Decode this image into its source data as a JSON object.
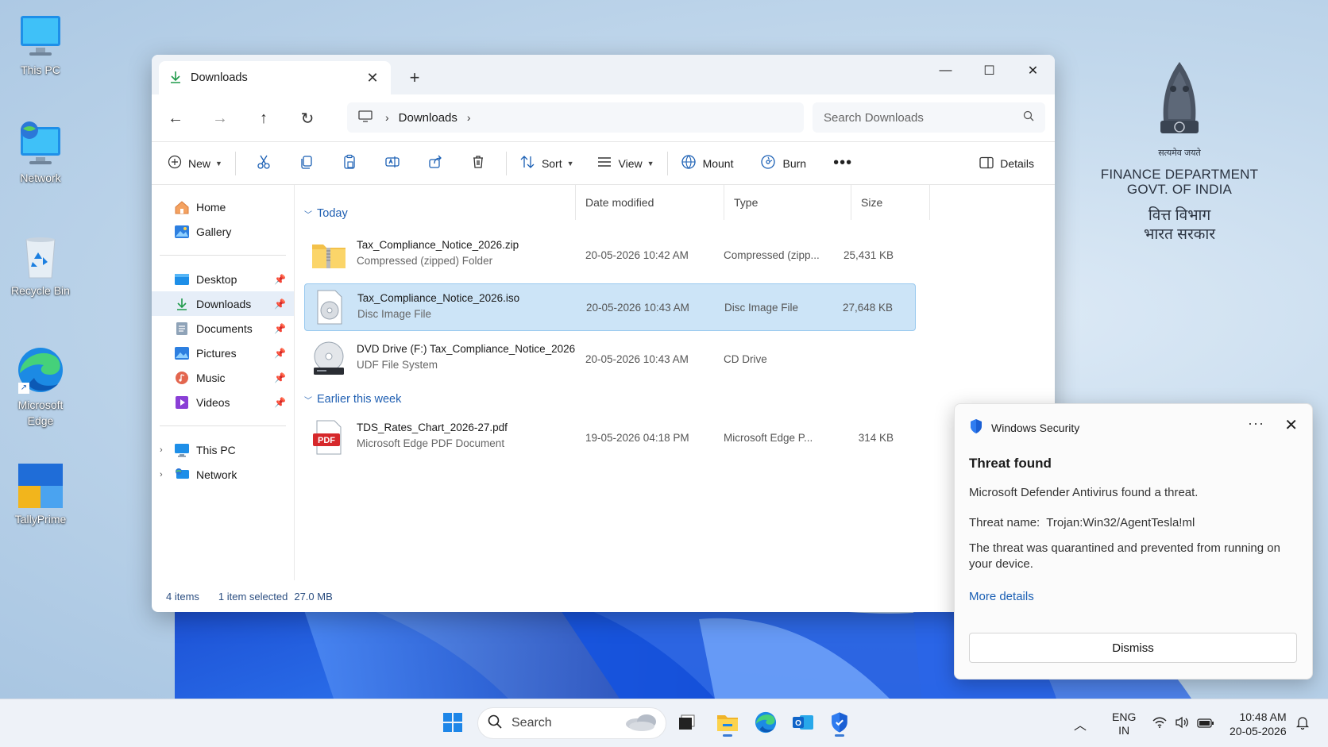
{
  "desktop": {
    "icons": [
      {
        "label": "This PC"
      },
      {
        "label": "Network"
      },
      {
        "label": "Recycle Bin"
      },
      {
        "label": "Microsoft Edge"
      },
      {
        "label": "TallyPrime"
      }
    ],
    "emblem": {
      "motto": "सत्यमेव जयते",
      "dept_line1": "FINANCE DEPARTMENT",
      "dept_line2": "GOVT. OF INDIA",
      "hindi_line1": "वित्त विभाग",
      "hindi_line2": "भारत सरकार"
    }
  },
  "explorer": {
    "tab_title": "Downloads",
    "address": {
      "crumb": "Downloads"
    },
    "search_placeholder": "Search Downloads",
    "commands": {
      "new": "New",
      "sort": "Sort",
      "view": "View",
      "mount": "Mount",
      "burn": "Burn",
      "details": "Details"
    },
    "sidebar": {
      "top": [
        {
          "label": "Home",
          "icon": "home-icon"
        },
        {
          "label": "Gallery",
          "icon": "gallery-icon"
        }
      ],
      "quick": [
        {
          "label": "Desktop",
          "icon": "desktop-folder-icon"
        },
        {
          "label": "Downloads",
          "icon": "downloads-folder-icon"
        },
        {
          "label": "Documents",
          "icon": "documents-folder-icon"
        },
        {
          "label": "Pictures",
          "icon": "pictures-folder-icon"
        },
        {
          "label": "Music",
          "icon": "music-folder-icon"
        },
        {
          "label": "Videos",
          "icon": "videos-folder-icon"
        }
      ],
      "bottom": [
        {
          "label": "This PC",
          "icon": "this-pc-icon"
        },
        {
          "label": "Network",
          "icon": "network-icon"
        }
      ]
    },
    "columns": {
      "name": "",
      "date": "Date modified",
      "type": "Type",
      "size": "Size"
    },
    "groups": [
      {
        "label": "Today"
      },
      {
        "label": "Earlier this week"
      }
    ],
    "files": [
      {
        "name": "Tax_Compliance_Notice_2026.zip",
        "sub": "Compressed (zipped) Folder",
        "date": "20-05-2026 10:42 AM",
        "type": "Compressed (zipp...",
        "size": "25,431 KB",
        "icon": "zip-folder-icon"
      },
      {
        "name": "Tax_Compliance_Notice_2026.iso",
        "sub": "Disc Image File",
        "date": "20-05-2026 10:43 AM",
        "type": "Disc Image File",
        "size": "27,648 KB",
        "icon": "disc-image-icon"
      },
      {
        "name": "DVD Drive (F:) Tax_Compliance_Notice_2026",
        "sub": "UDF File System",
        "date": "20-05-2026 10:43 AM",
        "type": "CD Drive",
        "size": "",
        "icon": "dvd-drive-icon"
      },
      {
        "name": "TDS_Rates_Chart_2026-27.pdf",
        "sub": "Microsoft Edge PDF Document",
        "date": "19-05-2026 04:18 PM",
        "type": "Microsoft Edge P...",
        "size": "314 KB",
        "icon": "pdf-icon"
      }
    ],
    "status": {
      "count": "4 items",
      "selected": "1 item selected",
      "size": "27.0 MB"
    }
  },
  "toast": {
    "app": "Windows Security",
    "title": "Threat found",
    "line1": "Microsoft Defender Antivirus found a threat.",
    "threat": "Threat name:  Trojan:Win32/AgentTesla!ml",
    "line3": "The threat was quarantined and prevented from running on your device.",
    "link": "More details",
    "dismiss": "Dismiss"
  },
  "taskbar": {
    "search": "Search",
    "lang1": "ENG",
    "lang2": "IN",
    "time": "10:48 AM",
    "date": "20-05-2026"
  }
}
